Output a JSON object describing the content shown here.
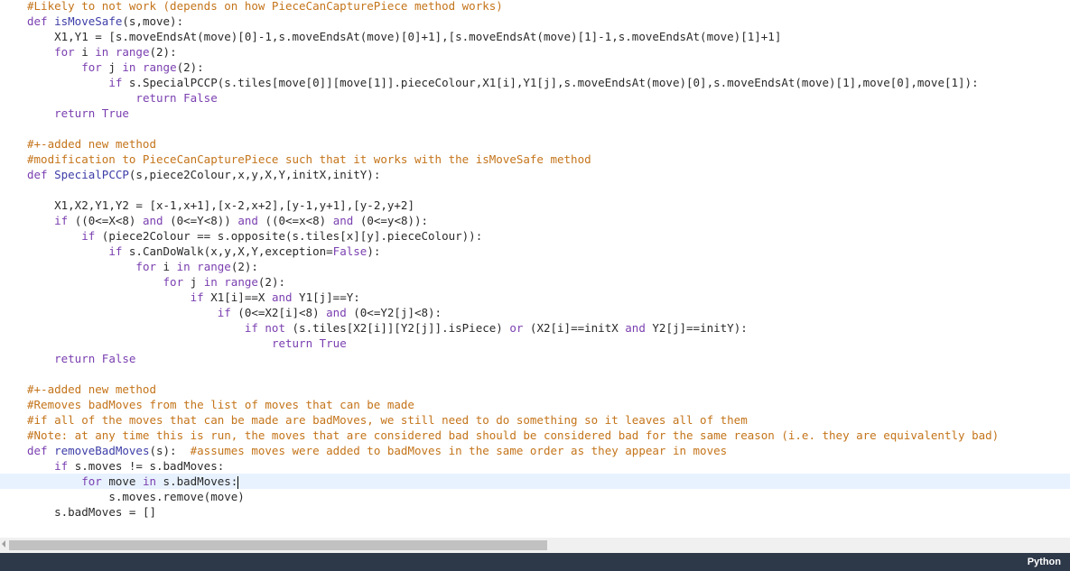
{
  "editor": {
    "lines": [
      {
        "indent": 0,
        "tokens": [
          {
            "t": "comment",
            "v": "#Likely to not work (depends on how PieceCanCapturePiece method works)"
          }
        ]
      },
      {
        "indent": 0,
        "tokens": [
          {
            "t": "keyword",
            "v": "def "
          },
          {
            "t": "func",
            "v": "isMoveSafe"
          },
          {
            "t": "text",
            "v": "(s,move):"
          }
        ]
      },
      {
        "indent": 4,
        "tokens": [
          {
            "t": "text",
            "v": "X1,Y1 = [s.moveEndsAt(move)[0]-1,s.moveEndsAt(move)[0]+1],[s.moveEndsAt(move)[1]-1,s.moveEndsAt(move)[1]+1]"
          }
        ]
      },
      {
        "indent": 4,
        "tokens": [
          {
            "t": "keyword",
            "v": "for "
          },
          {
            "t": "text",
            "v": "i "
          },
          {
            "t": "keyword",
            "v": "in "
          },
          {
            "t": "keyword",
            "v": "range"
          },
          {
            "t": "text",
            "v": "(2):"
          }
        ]
      },
      {
        "indent": 8,
        "tokens": [
          {
            "t": "keyword",
            "v": "for "
          },
          {
            "t": "text",
            "v": "j "
          },
          {
            "t": "keyword",
            "v": "in "
          },
          {
            "t": "keyword",
            "v": "range"
          },
          {
            "t": "text",
            "v": "(2):"
          }
        ]
      },
      {
        "indent": 12,
        "tokens": [
          {
            "t": "keyword",
            "v": "if "
          },
          {
            "t": "text",
            "v": "s.SpecialPCCP(s.tiles[move[0]][move[1]].pieceColour,X1[i],Y1[j],s.moveEndsAt(move)[0],s.moveEndsAt(move)[1],move[0],move[1]):"
          }
        ]
      },
      {
        "indent": 16,
        "tokens": [
          {
            "t": "keyword",
            "v": "return "
          },
          {
            "t": "keyword",
            "v": "False"
          }
        ]
      },
      {
        "indent": 4,
        "tokens": [
          {
            "t": "keyword",
            "v": "return "
          },
          {
            "t": "keyword",
            "v": "True"
          }
        ]
      },
      {
        "indent": 0,
        "tokens": []
      },
      {
        "indent": 0,
        "tokens": [
          {
            "t": "comment",
            "v": "#+-added new method"
          }
        ]
      },
      {
        "indent": 0,
        "tokens": [
          {
            "t": "comment",
            "v": "#modification to PieceCanCapturePiece such that it works with the isMoveSafe method"
          }
        ]
      },
      {
        "indent": 0,
        "tokens": [
          {
            "t": "keyword",
            "v": "def "
          },
          {
            "t": "func",
            "v": "SpecialPCCP"
          },
          {
            "t": "text",
            "v": "(s,piece2Colour,x,y,X,Y,initX,initY):"
          }
        ]
      },
      {
        "indent": 0,
        "tokens": []
      },
      {
        "indent": 4,
        "tokens": [
          {
            "t": "text",
            "v": "X1,X2,Y1,Y2 = [x-1,x+1],[x-2,x+2],[y-1,y+1],[y-2,y+2]"
          }
        ]
      },
      {
        "indent": 4,
        "tokens": [
          {
            "t": "keyword",
            "v": "if "
          },
          {
            "t": "text",
            "v": "((0<=X<8) "
          },
          {
            "t": "keyword",
            "v": "and "
          },
          {
            "t": "text",
            "v": "(0<=Y<8)) "
          },
          {
            "t": "keyword",
            "v": "and "
          },
          {
            "t": "text",
            "v": "((0<=x<8) "
          },
          {
            "t": "keyword",
            "v": "and "
          },
          {
            "t": "text",
            "v": "(0<=y<8)):"
          }
        ]
      },
      {
        "indent": 8,
        "tokens": [
          {
            "t": "keyword",
            "v": "if "
          },
          {
            "t": "text",
            "v": "(piece2Colour == s.opposite(s.tiles[x][y].pieceColour)):"
          }
        ]
      },
      {
        "indent": 12,
        "tokens": [
          {
            "t": "keyword",
            "v": "if "
          },
          {
            "t": "text",
            "v": "s.CanDoWalk(x,y,X,Y,exception="
          },
          {
            "t": "keyword",
            "v": "False"
          },
          {
            "t": "text",
            "v": "):"
          }
        ]
      },
      {
        "indent": 16,
        "tokens": [
          {
            "t": "keyword",
            "v": "for "
          },
          {
            "t": "text",
            "v": "i "
          },
          {
            "t": "keyword",
            "v": "in "
          },
          {
            "t": "keyword",
            "v": "range"
          },
          {
            "t": "text",
            "v": "(2):"
          }
        ]
      },
      {
        "indent": 20,
        "tokens": [
          {
            "t": "keyword",
            "v": "for "
          },
          {
            "t": "text",
            "v": "j "
          },
          {
            "t": "keyword",
            "v": "in "
          },
          {
            "t": "keyword",
            "v": "range"
          },
          {
            "t": "text",
            "v": "(2):"
          }
        ]
      },
      {
        "indent": 24,
        "tokens": [
          {
            "t": "keyword",
            "v": "if "
          },
          {
            "t": "text",
            "v": "X1[i]==X "
          },
          {
            "t": "keyword",
            "v": "and "
          },
          {
            "t": "text",
            "v": "Y1[j]==Y:"
          }
        ]
      },
      {
        "indent": 28,
        "tokens": [
          {
            "t": "keyword",
            "v": "if "
          },
          {
            "t": "text",
            "v": "(0<=X2[i]<8) "
          },
          {
            "t": "keyword",
            "v": "and "
          },
          {
            "t": "text",
            "v": "(0<=Y2[j]<8):"
          }
        ]
      },
      {
        "indent": 32,
        "tokens": [
          {
            "t": "keyword",
            "v": "if not "
          },
          {
            "t": "text",
            "v": "(s.tiles[X2[i]][Y2[j]].isPiece) "
          },
          {
            "t": "keyword",
            "v": "or "
          },
          {
            "t": "text",
            "v": "(X2[i]==initX "
          },
          {
            "t": "keyword",
            "v": "and "
          },
          {
            "t": "text",
            "v": "Y2[j]==initY):"
          }
        ]
      },
      {
        "indent": 36,
        "tokens": [
          {
            "t": "keyword",
            "v": "return "
          },
          {
            "t": "keyword",
            "v": "True"
          }
        ]
      },
      {
        "indent": 4,
        "tokens": [
          {
            "t": "keyword",
            "v": "return "
          },
          {
            "t": "keyword",
            "v": "False"
          }
        ]
      },
      {
        "indent": 0,
        "tokens": []
      },
      {
        "indent": 0,
        "tokens": [
          {
            "t": "comment",
            "v": "#+-added new method"
          }
        ]
      },
      {
        "indent": 0,
        "tokens": [
          {
            "t": "comment",
            "v": "#Removes badMoves from the list of moves that can be made"
          }
        ]
      },
      {
        "indent": 0,
        "tokens": [
          {
            "t": "comment",
            "v": "#if all of the moves that can be made are badMoves, we still need to do something so it leaves all of them"
          }
        ]
      },
      {
        "indent": 0,
        "tokens": [
          {
            "t": "comment",
            "v": "#Note: at any time this is run, the moves that are considered bad should be considered bad for the same reason (i.e. they are equivalently bad)"
          }
        ]
      },
      {
        "indent": 0,
        "tokens": [
          {
            "t": "keyword",
            "v": "def "
          },
          {
            "t": "func",
            "v": "removeBadMoves"
          },
          {
            "t": "text",
            "v": "(s):  "
          },
          {
            "t": "comment",
            "v": "#assumes moves were added to badMoves in the same order as they appear in moves"
          }
        ]
      },
      {
        "indent": 4,
        "tokens": [
          {
            "t": "keyword",
            "v": "if "
          },
          {
            "t": "text",
            "v": "s.moves != s.badMoves:"
          }
        ]
      },
      {
        "indent": 8,
        "active": true,
        "tokens": [
          {
            "t": "keyword",
            "v": "for "
          },
          {
            "t": "text",
            "v": "move "
          },
          {
            "t": "keyword",
            "v": "in "
          },
          {
            "t": "text",
            "v": "s.badMoves:"
          }
        ]
      },
      {
        "indent": 12,
        "tokens": [
          {
            "t": "text",
            "v": "s.moves.remove(move)"
          }
        ]
      },
      {
        "indent": 4,
        "tokens": [
          {
            "t": "text",
            "v": "s.badMoves = []"
          }
        ]
      }
    ]
  },
  "statusbar": {
    "language": "Python"
  },
  "colors": {
    "comment": "#c4741a",
    "keyword": "#7a3fb0",
    "function": "#3d3da8",
    "statusbar_bg": "#2d3848",
    "active_line": "#e8f2ff"
  }
}
